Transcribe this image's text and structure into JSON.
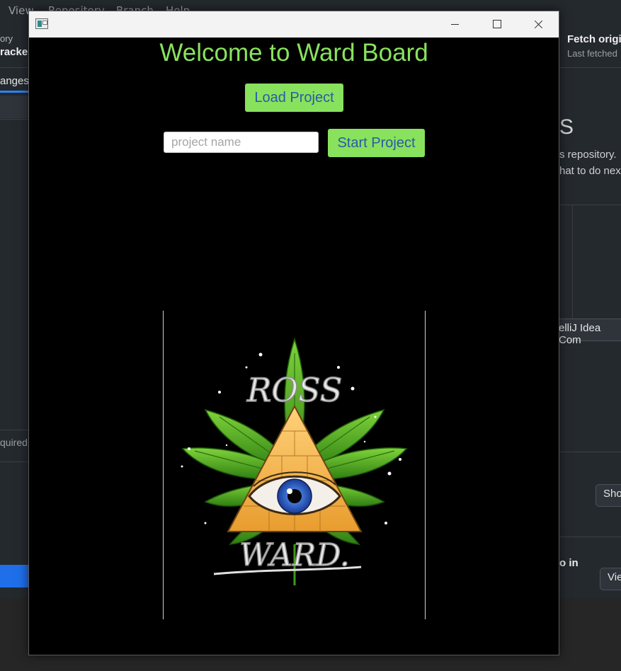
{
  "background_app": {
    "menu": [
      "View",
      "Repository",
      "Branch",
      "Help"
    ],
    "left_panel": {
      "repo_label": "ory",
      "repo_name": "racker",
      "changes_tab": "anges",
      "required_text": "quired"
    },
    "right_panel": {
      "fetch_title": "Fetch origin",
      "fetch_sub": "Last fetched",
      "heading_fragment": "S",
      "line1": "s repository.",
      "line2": "hat to do nex",
      "intellij_text": "elliJ Idea Com",
      "show_button": "Sho",
      "open_text": "o in",
      "view_button": "Vie"
    }
  },
  "window": {
    "title": "",
    "welcome": "Welcome to Ward Board",
    "load_button": "Load Project",
    "project_name_placeholder": "project name",
    "project_name_value": "",
    "start_button": "Start Project",
    "logo": {
      "top_text": "ROSS",
      "bottom_text": "WARD."
    }
  },
  "colors": {
    "accent_green": "#88e25d",
    "button_text_blue": "#2b5aa8",
    "window_bg": "#000000",
    "pyramid_orange": "#f1b54d",
    "leaf_green": "#3f9a1b"
  }
}
